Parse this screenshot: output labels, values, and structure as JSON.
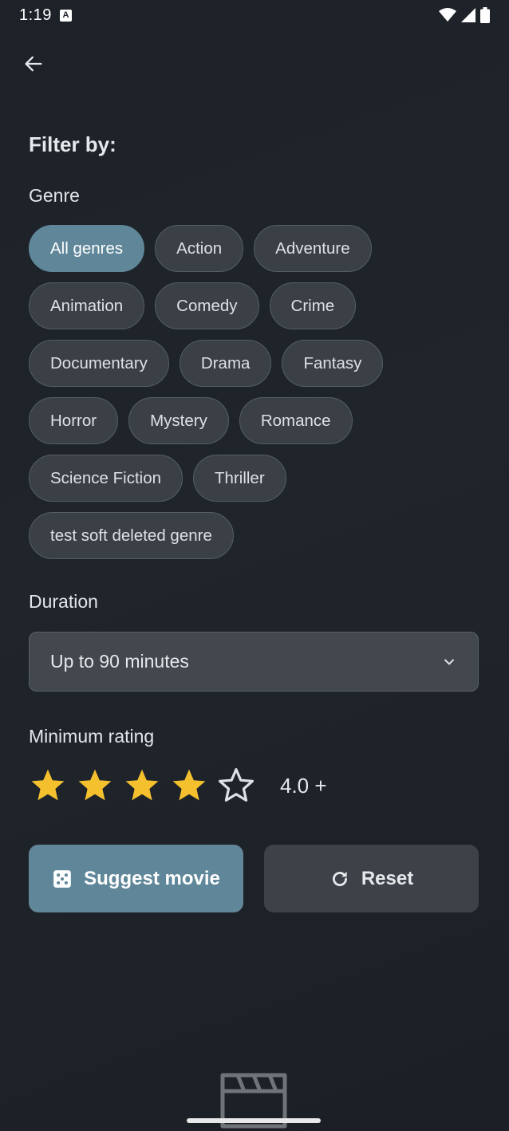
{
  "status_bar": {
    "time": "1:19",
    "notification_badge": "A"
  },
  "header": {
    "back_icon": "arrow-left-icon"
  },
  "filter": {
    "title": "Filter by:",
    "genre_label": "Genre",
    "genre_rows": [
      [
        {
          "label": "All genres",
          "selected": true
        },
        {
          "label": "Action"
        },
        {
          "label": "Adventure"
        }
      ],
      [
        {
          "label": "Animation"
        },
        {
          "label": "Comedy"
        },
        {
          "label": "Crime"
        }
      ],
      [
        {
          "label": "Documentary"
        },
        {
          "label": "Drama"
        },
        {
          "label": "Fantasy"
        }
      ],
      [
        {
          "label": "Horror"
        },
        {
          "label": "Mystery"
        },
        {
          "label": "Romance"
        }
      ],
      [
        {
          "label": "Science Fiction"
        },
        {
          "label": "Thriller"
        }
      ],
      [
        {
          "label": "test soft deleted genre"
        }
      ]
    ],
    "duration_label": "Duration",
    "duration_value": "Up to 90 minutes",
    "rating_label": "Minimum rating",
    "rating_value": 4,
    "rating_max": 5,
    "rating_text": "4.0 +"
  },
  "actions": {
    "suggest_label": "Suggest movie",
    "suggest_icon": "dice-icon",
    "reset_label": "Reset",
    "reset_icon": "refresh-icon"
  },
  "colors": {
    "accent": "#5f8799",
    "star": "#f5c02e",
    "background": "#1e2329"
  }
}
